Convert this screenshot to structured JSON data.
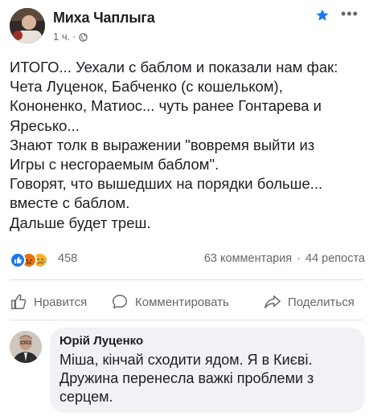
{
  "post": {
    "author": "Миха Чаплыга",
    "time": "1 ч.",
    "dot": "·",
    "more": "•••",
    "lines": [
      "ИТОГО... Уехали с баблом и показали нам фак:",
      "Чета Луценок, Бабченко (с кошельком),",
      "Кононенко, Матиос... чуть ранее Гонтарева и",
      "Яресько...",
      "Знают толк в выражении \"вовремя выйти из",
      "Игры с несгораемым баблом\".",
      "Говорят, что вышедших на порядки больше...",
      "вместе с баблом.",
      "Дальше будет треш."
    ]
  },
  "stats": {
    "reaction_count": "458",
    "comments": "63 комментария",
    "separator": "·",
    "shares": "44 репоста"
  },
  "actions": {
    "like": "Нравится",
    "comment": "Комментировать",
    "share": "Поделиться"
  },
  "comment": {
    "author": "Юрій Луценко",
    "lines": [
      "Міша, кінчай сходити ядом. Я в Києві.",
      "Дружина перенесла важкі проблеми з",
      "серцем."
    ]
  },
  "colors": {
    "accent": "#1877f2",
    "angry": "#e9710f",
    "sad": "#f7b125",
    "muted": "#65676b",
    "bubble": "#f0f2f5"
  }
}
